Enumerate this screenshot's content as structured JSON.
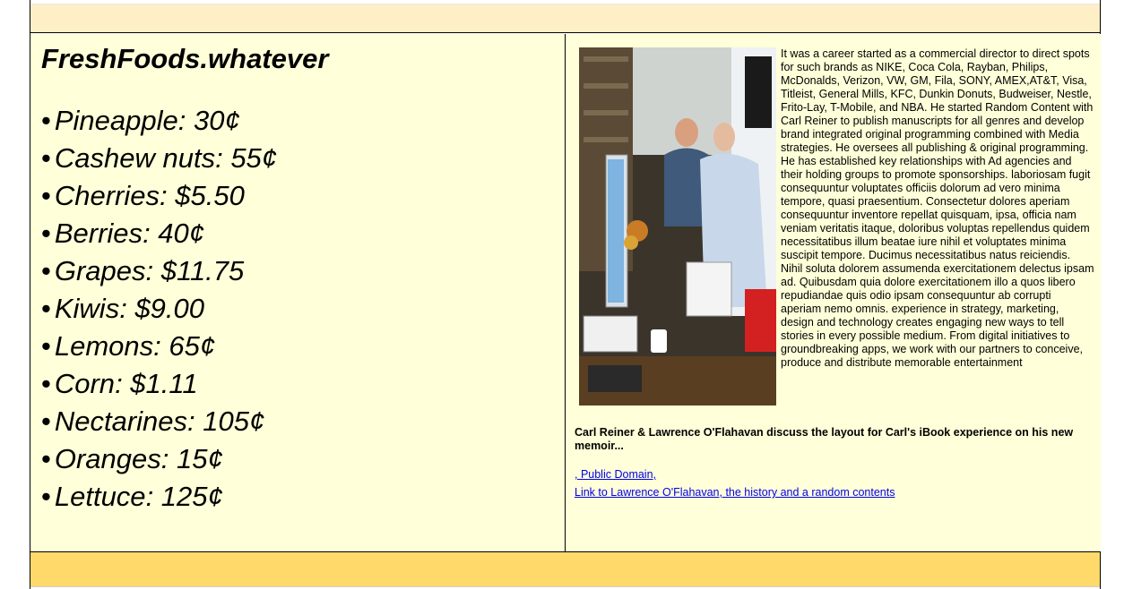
{
  "site": {
    "title": "FreshFoods.whatever"
  },
  "products": [
    {
      "name": "Pineapple",
      "price": "30¢"
    },
    {
      "name": "Cashew nuts",
      "price": "55¢"
    },
    {
      "name": "Cherries",
      "price": "$5.50"
    },
    {
      "name": "Berries",
      "price": "40¢"
    },
    {
      "name": "Grapes",
      "price": "$11.75"
    },
    {
      "name": "Kiwis",
      "price": "$9.00"
    },
    {
      "name": "Lemons",
      "price": "65¢"
    },
    {
      "name": "Corn",
      "price": "$1.11"
    },
    {
      "name": "Nectarines",
      "price": "105¢"
    },
    {
      "name": "Oranges",
      "price": "15¢"
    },
    {
      "name": "Lettuce",
      "price": "125¢"
    }
  ],
  "article": {
    "bio": "It was a career started as a commercial director to direct spots for such brands as NIKE, Coca Cola, Rayban, Philips, McDonalds, Verizon, VW, GM, Fila, SONY, AMEX,AT&T, Visa, Titleist, General Mills, KFC, Dunkin Donuts, Budweiser, Nestle, Frito-Lay, T-Mobile, and NBA. He started Random Content with Carl Reiner to publish manuscripts for all genres and develop brand integrated original programming combined with Media strategies. He oversees all publishing & original programming. He has established key relationships with Ad agencies and their holding groups to promote sponsorships. laboriosam fugit consequuntur voluptates officiis dolorum ad vero minima tempore, quasi praesentium. Consectetur dolores aperiam consequuntur inventore repellat quisquam, ipsa, officia nam veniam veritatis itaque, doloribus voluptas repellendus quidem necessitatibus illum beatae iure nihil et voluptates minima suscipit tempore. Ducimus necessitatibus natus reiciendis. Nihil soluta dolorem assumenda exercitationem delectus ipsam ad. Quibusdam quia dolore exercitationem illo a quos libero repudiandae quis odio ipsam consequuntur ab corrupti aperiam nemo omnis. experience in strategy, marketing, design and technology creates engaging new ways to tell stories in every possible medium. From digital initiatives to groundbreaking apps, we work with our partners to conceive, produce and distribute memorable entertainment",
    "caption": "Carl Reiner & Lawrence O'Flahavan discuss the layout for Carl's iBook experience on his new memoir...",
    "links": {
      "domain": ", Public Domain,",
      "history": "Link to Lawrence O'Flahavan, the history and a random contents"
    }
  },
  "colors": {
    "header_band": "#ffefc6",
    "footer_band": "#ffda6b",
    "panel_background": "#ffffd9",
    "link": "#0000ee"
  }
}
